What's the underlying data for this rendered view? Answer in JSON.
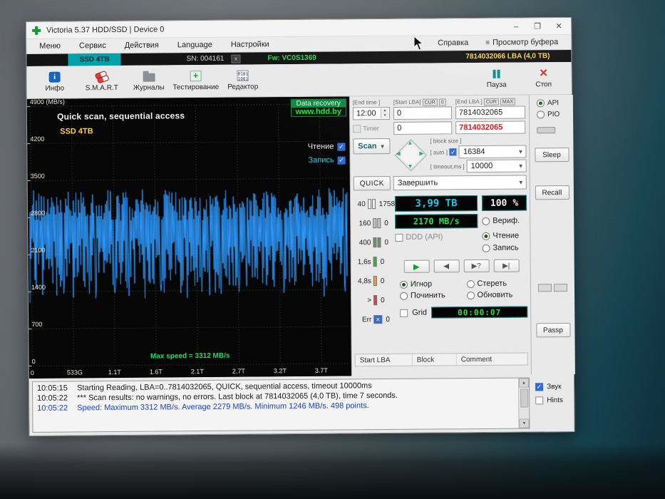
{
  "window": {
    "title": "Victoria 5.37 HDD/SSD | Device 0",
    "minimize": "–",
    "maximize": "❒",
    "close": "✕"
  },
  "menu": {
    "items": [
      "Меню",
      "Сервис",
      "Действия",
      "Language",
      "Настройки"
    ],
    "right_items": [
      "Справка",
      "Просмотр буфера"
    ]
  },
  "infobar": {
    "model": "SSD 4TB",
    "sn": "SN: 004161",
    "close_x": "x",
    "fw": "Fw: VC0S1369",
    "capacity": "7814032066 LBA (4,0 TB)"
  },
  "toolbar": {
    "buttons": [
      {
        "label": "Инфо"
      },
      {
        "label": "S.M.A.R.T"
      },
      {
        "label": "Журналы"
      },
      {
        "label": "Тестирование"
      },
      {
        "label": "Редактор"
      }
    ],
    "pause": "Пауза",
    "stop": "Стоп"
  },
  "chart_data": {
    "type": "line",
    "title": "Quick scan, sequential access",
    "series_label": "SSD 4TB",
    "ylabel": "MB/s",
    "ylim": [
      0,
      4900
    ],
    "y_ticks": [
      "4900 (MB/s)",
      "4200",
      "3500",
      "2800",
      "2100",
      "1400",
      "700",
      "0"
    ],
    "y_values": [
      4900,
      4200,
      3500,
      2800,
      2100,
      1400,
      700,
      0
    ],
    "x_ticks": [
      "0",
      "533G",
      "1.1T",
      "1.6T",
      "2.1T",
      "2.7T",
      "3.2T",
      "3.7T"
    ],
    "stats": {
      "max": 3312,
      "avg": 2279,
      "min": 1246,
      "points": 498
    },
    "line_color": "#2f9bff",
    "grid": true
  },
  "graph_overlay": {
    "brand_line1": "Data recovery",
    "brand_line2": "www.hdd.by",
    "legend_read": "Чтение",
    "legend_write": "Запись",
    "max_speed": "Max speed = 3312 MB/s"
  },
  "panel": {
    "end_time_label": "[End time ]",
    "end_time": "12:00",
    "start_lba_label": "[Start LBA]",
    "cur_btn": "CUR",
    "zero_btn": "0",
    "start_lba": "0",
    "end_lba_label": "[End LBA ]",
    "max_btn": "MAX",
    "end_lba": "7814032065",
    "timer_label": "Timer",
    "timer_value": "0",
    "end_lba_red": "7814032065",
    "scan_label": "Scan",
    "block_size_label": "[ block size ]",
    "auto_label": "[ auto ]",
    "block_size": "16384",
    "timeout_label": "[ timeout,ms ]",
    "timeout": "10000",
    "quick_label": "QUICK",
    "finish_label": "Завершить",
    "counters": [
      {
        "label": "40",
        "count": "1758",
        "color": "#ededed"
      },
      {
        "label": "160",
        "count": "0",
        "color": "#c4c4c4"
      },
      {
        "label": "400",
        "count": "0",
        "color": "#6f8f6f"
      },
      {
        "label": "1,6s",
        "count": "0",
        "color": "#2eb82e"
      },
      {
        "label": "4,8s",
        "count": "0",
        "color": "#ff9a2a"
      },
      {
        "label": ">",
        "count": "0",
        "color": "#ef3b2f"
      },
      {
        "label": "Err",
        "count": "0",
        "color": "#2f6bd8"
      }
    ],
    "size_display": "3,99 TB",
    "percent_value": "100",
    "percent_unit": "%",
    "speed_display": "2170 MB/s",
    "ddd_label": "DDD (API)",
    "mode_radios": [
      "Вериф.",
      "Чтение",
      "Запись"
    ],
    "transport_icons": [
      "▶",
      "◀",
      "▶?",
      "▶|"
    ],
    "action_radios": [
      "Игнор",
      "Стереть",
      "Починить",
      "Обновить"
    ],
    "grid_label": "Grid",
    "timer_display": "00:00:07",
    "table_headers": [
      "Start LBA",
      "Block",
      "Comment"
    ]
  },
  "rightstrip": {
    "api": "API",
    "pio": "PIO",
    "sleep": "Sleep",
    "recall": "Recall",
    "passp": "Passp"
  },
  "log": {
    "rows": [
      {
        "time": "10:05:15",
        "text": "Starting Reading, LBA=0..7814032065, QUICK, sequential access, timeout 10000ms",
        "color": "#1b1b1b"
      },
      {
        "time": "10:05:22",
        "text": "*** Scan results: no warnings, no errors. Last block at 7814032065 (4,0 TB), time 7 seconds.",
        "color": "#1b1b1b"
      },
      {
        "time": "10:05:22",
        "text": "Speed: Maximum 3312 MB/s. Average 2279 MB/s. Minimum 1246 MB/s. 498 points.",
        "color": "#1a3fd4"
      }
    ]
  },
  "footer": {
    "sound": "Звук",
    "hints": "Hints"
  }
}
